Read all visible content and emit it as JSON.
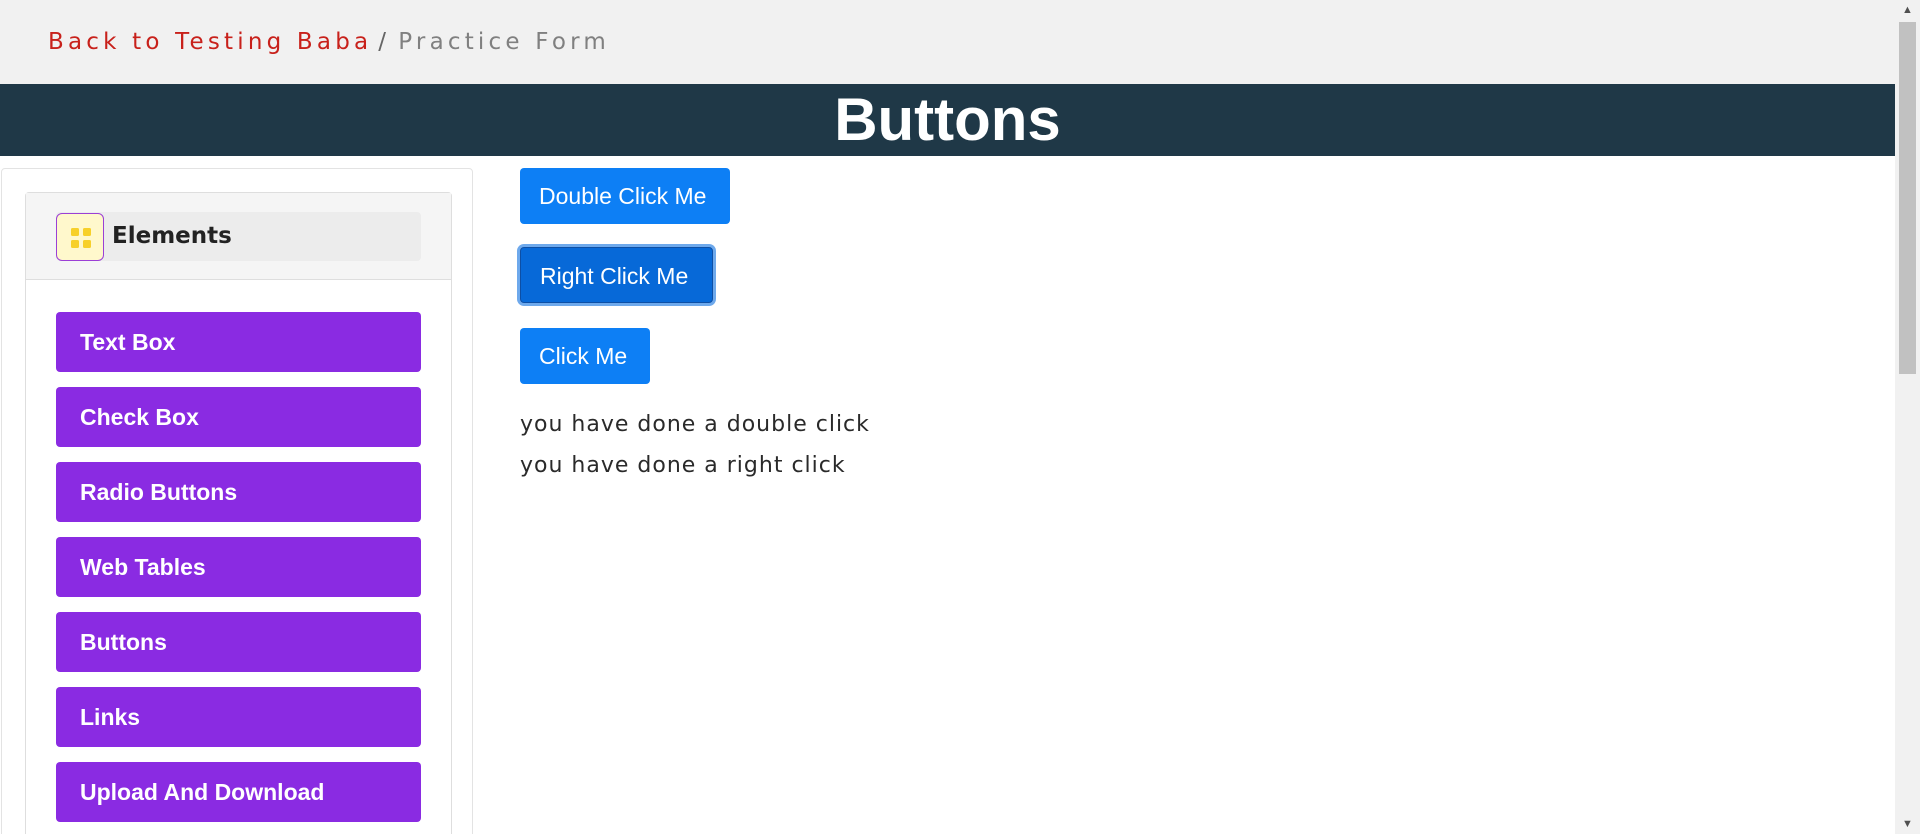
{
  "breadcrumb": {
    "back_label": "Back to Testing Baba",
    "separator": "/",
    "current": "Practice Form"
  },
  "banner": {
    "title": "Buttons"
  },
  "sidebar": {
    "group_title": "Elements",
    "group_icon": "grid-icon",
    "items": [
      {
        "label": "Text Box"
      },
      {
        "label": "Check Box"
      },
      {
        "label": "Radio Buttons"
      },
      {
        "label": "Web Tables"
      },
      {
        "label": "Buttons"
      },
      {
        "label": "Links"
      },
      {
        "label": "Upload And Download"
      }
    ]
  },
  "main": {
    "double_click_label": "Double Click Me",
    "right_click_label": "Right Click Me",
    "click_label": "Click Me",
    "double_click_result": "you have done a double click",
    "right_click_result": "you have done a right click"
  },
  "colors": {
    "brand_purple": "#8a2be2",
    "banner_bg": "#1f3847",
    "button_blue": "#0d7ff5",
    "link_red": "#c8211b"
  }
}
